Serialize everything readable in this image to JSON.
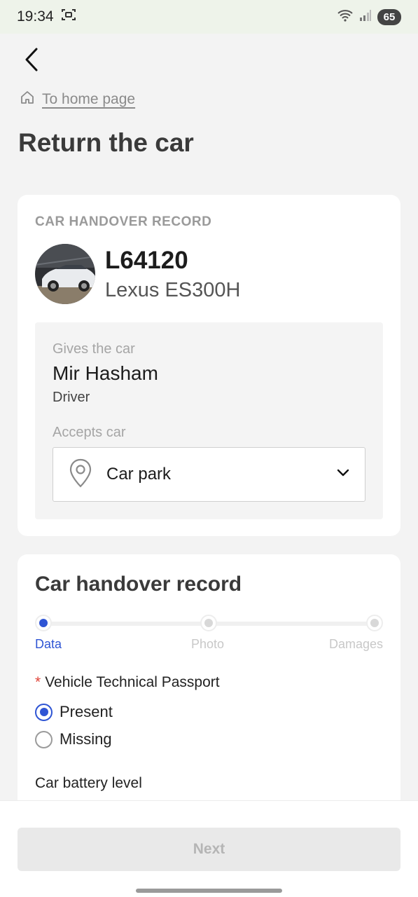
{
  "status_bar": {
    "time": "19:34",
    "battery": "65"
  },
  "breadcrumb": {
    "label": "To home page"
  },
  "page": {
    "title": "Return the car"
  },
  "record_card": {
    "caption": "CAR HANDOVER RECORD",
    "plate": "L64120",
    "model": "Lexus ES300H",
    "gives_label": "Gives the car",
    "driver_name": "Mir Hasham",
    "driver_role": "Driver",
    "accepts_label": "Accepts car",
    "accepts_value": "Car park"
  },
  "handover_form": {
    "title": "Car handover record",
    "steps": [
      {
        "label": "Data",
        "active": true
      },
      {
        "label": "Photo",
        "active": false
      },
      {
        "label": "Damages",
        "active": false
      }
    ],
    "passport_label": "Vehicle Technical Passport",
    "passport_options": [
      {
        "label": "Present",
        "checked": true
      },
      {
        "label": "Missing",
        "checked": false
      }
    ],
    "battery_label": "Car battery level"
  },
  "footer": {
    "next_label": "Next"
  },
  "colors": {
    "accent": "#2f55d4",
    "required": "#e0463b"
  },
  "icons": [
    "screenshot-icon",
    "wifi-icon",
    "signal-icon",
    "back-arrow-icon",
    "home-icon",
    "location-pin-icon",
    "chevron-down-icon"
  ]
}
